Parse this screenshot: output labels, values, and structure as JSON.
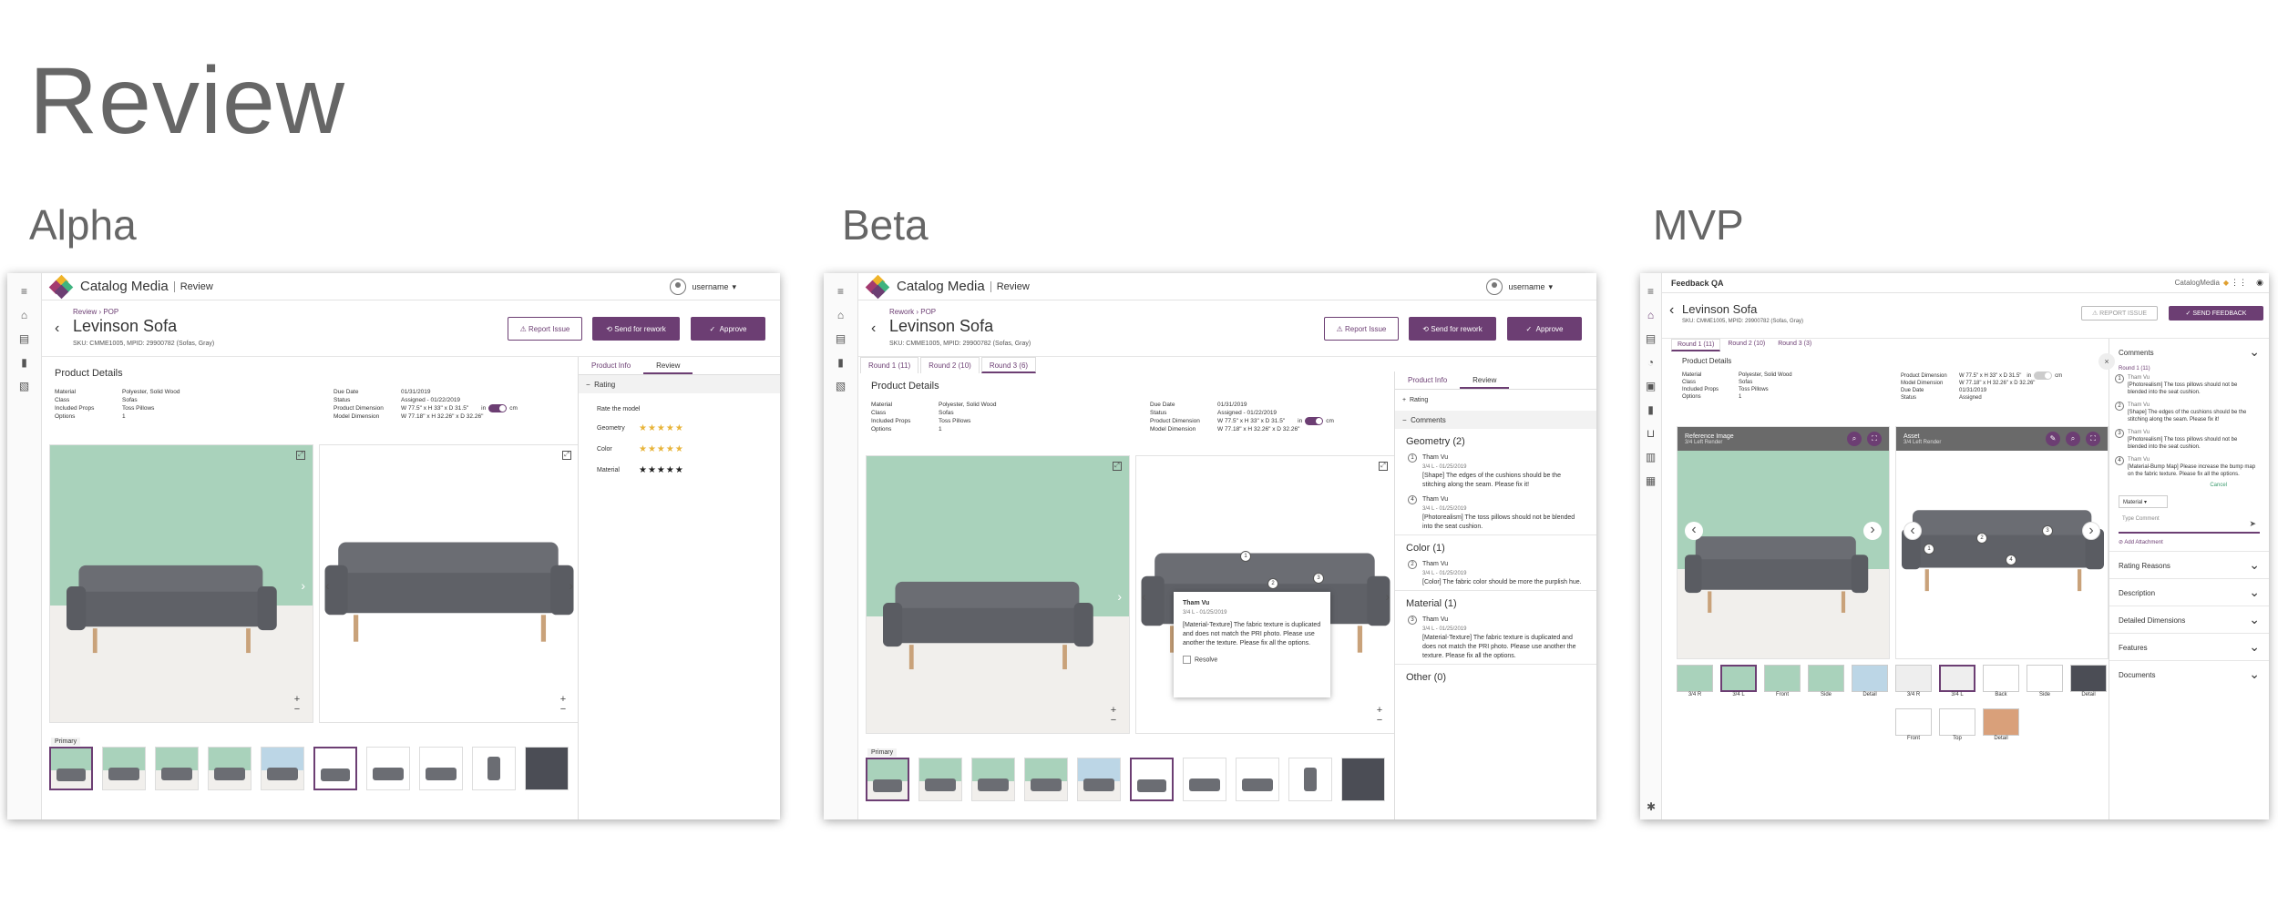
{
  "page": {
    "title": "Review"
  },
  "columns": [
    "Alpha",
    "Beta",
    "MVP"
  ],
  "common": {
    "brand": "Catalog Media",
    "brand_section": "Review",
    "username": "username",
    "product_name": "Levinson Sofa",
    "sku": "SKU: CMME1005, MPID: 29900782 (Sofas, Gray)",
    "report_issue": "Report Issue",
    "send_rework": "Send for rework",
    "approve": "Approve",
    "product_details": "Product Details",
    "primary": "Primary",
    "specs_left": [
      {
        "k": "Material",
        "v": "Polyester, Solid Wood"
      },
      {
        "k": "Class",
        "v": "Sofas"
      },
      {
        "k": "Included Props",
        "v": "Toss Pillows"
      },
      {
        "k": "Options",
        "v": "1"
      }
    ],
    "specs_right": [
      {
        "k": "Due Date",
        "v": "01/31/2019"
      },
      {
        "k": "Status",
        "v": "Assigned - 01/22/2019"
      },
      {
        "k": "Product Dimension",
        "v": "W 77.5\" x H 33\" x D 31.5\""
      },
      {
        "k": "Model Dimension",
        "v": "W 77.18\" x H 32.26\" x D 32.26\""
      }
    ],
    "unit_in": "in",
    "unit_cm": "cm",
    "product_info_tab": "Product Info",
    "review_tab": "Review"
  },
  "alpha": {
    "breadcrumb": "Review  ›  POP",
    "rating_label": "Rating",
    "rate_prompt": "Rate the model",
    "ratings": [
      {
        "label": "Geometry",
        "stars": "★★★★★"
      },
      {
        "label": "Color",
        "stars": "★★★★★"
      },
      {
        "label": "Material",
        "stars": "★★★★★"
      }
    ]
  },
  "beta": {
    "breadcrumb": "Rework  ›  POP",
    "rounds": [
      "Round 1 (11)",
      "Round 2 (10)",
      "Round 3 (6)"
    ],
    "rating_label": "Rating",
    "comments_label": "Comments",
    "groups": [
      {
        "title": "Geometry (2)",
        "comments": [
          {
            "n": "1",
            "author": "Tham Vu",
            "date": "3/4 L - 01/25/2019",
            "text": "[Shape] The edges of the cushions should be the stitching along the seam. Please fix it!"
          },
          {
            "n": "4",
            "author": "Tham Vu",
            "date": "3/4 L - 01/25/2019",
            "text": "[Photorealism] The toss pillows should not be blended into the seat cushion."
          }
        ]
      },
      {
        "title": "Color (1)",
        "comments": [
          {
            "n": "2",
            "author": "Tham Vu",
            "date": "3/4 L - 01/25/2019",
            "text": "[Color] The fabric color should be more the purplish hue."
          }
        ]
      },
      {
        "title": "Material (1)",
        "comments": [
          {
            "n": "3",
            "author": "Tham Vu",
            "date": "3/4 L - 01/25/2019",
            "text": "[Material-Texture] The fabric texture is duplicated and does not match the PRI photo. Please use another the texture. Please fix all the options."
          }
        ]
      },
      {
        "title": "Other (0)",
        "comments": []
      }
    ],
    "popup": {
      "author": "Tham Vu",
      "date": "3/4 L - 01/25/2019",
      "text": "[Material-Texture] The fabric texture is duplicated and does not match the PRI photo. Please use another the texture. Please fix all the options.",
      "resolve": "Resolve"
    }
  },
  "mvp": {
    "app_title": "Feedback QA",
    "brand": "CatalogMedia",
    "sku": "SKU: CMME1005, MPID: 29900782 (Sofas, Gray)",
    "report_issue": "REPORT ISSUE",
    "send_feedback": "SEND FEEDBACK",
    "rounds": [
      "Round 1 (11)",
      "Round 2 (10)",
      "Round 3 (3)"
    ],
    "product_details": "Product Details",
    "specs_left": [
      {
        "k": "Material",
        "v": "Polyester, Solid Wood"
      },
      {
        "k": "Class",
        "v": "Sofas"
      },
      {
        "k": "Included Props",
        "v": "Toss Pillows"
      },
      {
        "k": "Options",
        "v": "1"
      }
    ],
    "specs_right": [
      {
        "k": "Product Dimension",
        "v": "W 77.5\" x H 33\" x D 31.5\""
      },
      {
        "k": "Model Dimension",
        "v": "W 77.18\" x H 32.26\" x D 32.26\""
      },
      {
        "k": "Due Date",
        "v": "01/31/2019"
      },
      {
        "k": "Status",
        "v": "Assigned"
      }
    ],
    "reference_label": "Reference Image",
    "reference_sub": "3/4 Left Render",
    "asset_label": "Asset",
    "asset_sub": "3/4 Left Render",
    "thumb_labels_left": [
      "3/4 R",
      "3/4 L",
      "Front",
      "Side",
      "Detail"
    ],
    "thumb_labels_right": [
      "3/4 R",
      "3/4 L",
      "Back",
      "Side",
      "Detail"
    ],
    "thumb_labels_row2": [
      "Front",
      "Top",
      "Detail"
    ],
    "comments_label": "Comments",
    "round_label": "Round 1 (11)",
    "comments": [
      {
        "n": "1",
        "author": "Tham Vu",
        "text": "[Photorealism] The toss pillows should not be blended into the seat cushion."
      },
      {
        "n": "2",
        "author": "Tham Vu",
        "text": "[Shape] The edges of the cushions should be the stitching along the seam. Please fix it!"
      },
      {
        "n": "3",
        "author": "Tham Vu",
        "text": "[Photorealism] The toss pillows should not be blended into the seat cushion."
      },
      {
        "n": "4",
        "author": "Tham Vu",
        "text": "[Material-Bump Map] Please increase the bump map on the fabric texture. Please fix all the options."
      }
    ],
    "cancel": "Cancel",
    "material_select": "Material",
    "type_placeholder": "Type Comment",
    "add_attachment": "Add Attachment",
    "accordions": [
      "Rating Reasons",
      "Description",
      "Detailed Dimensions",
      "Features",
      "Documents"
    ]
  },
  "colors": {
    "accent": "#6c3e73",
    "wall": "#a9d2bb",
    "sofa": "#6b6d73"
  }
}
